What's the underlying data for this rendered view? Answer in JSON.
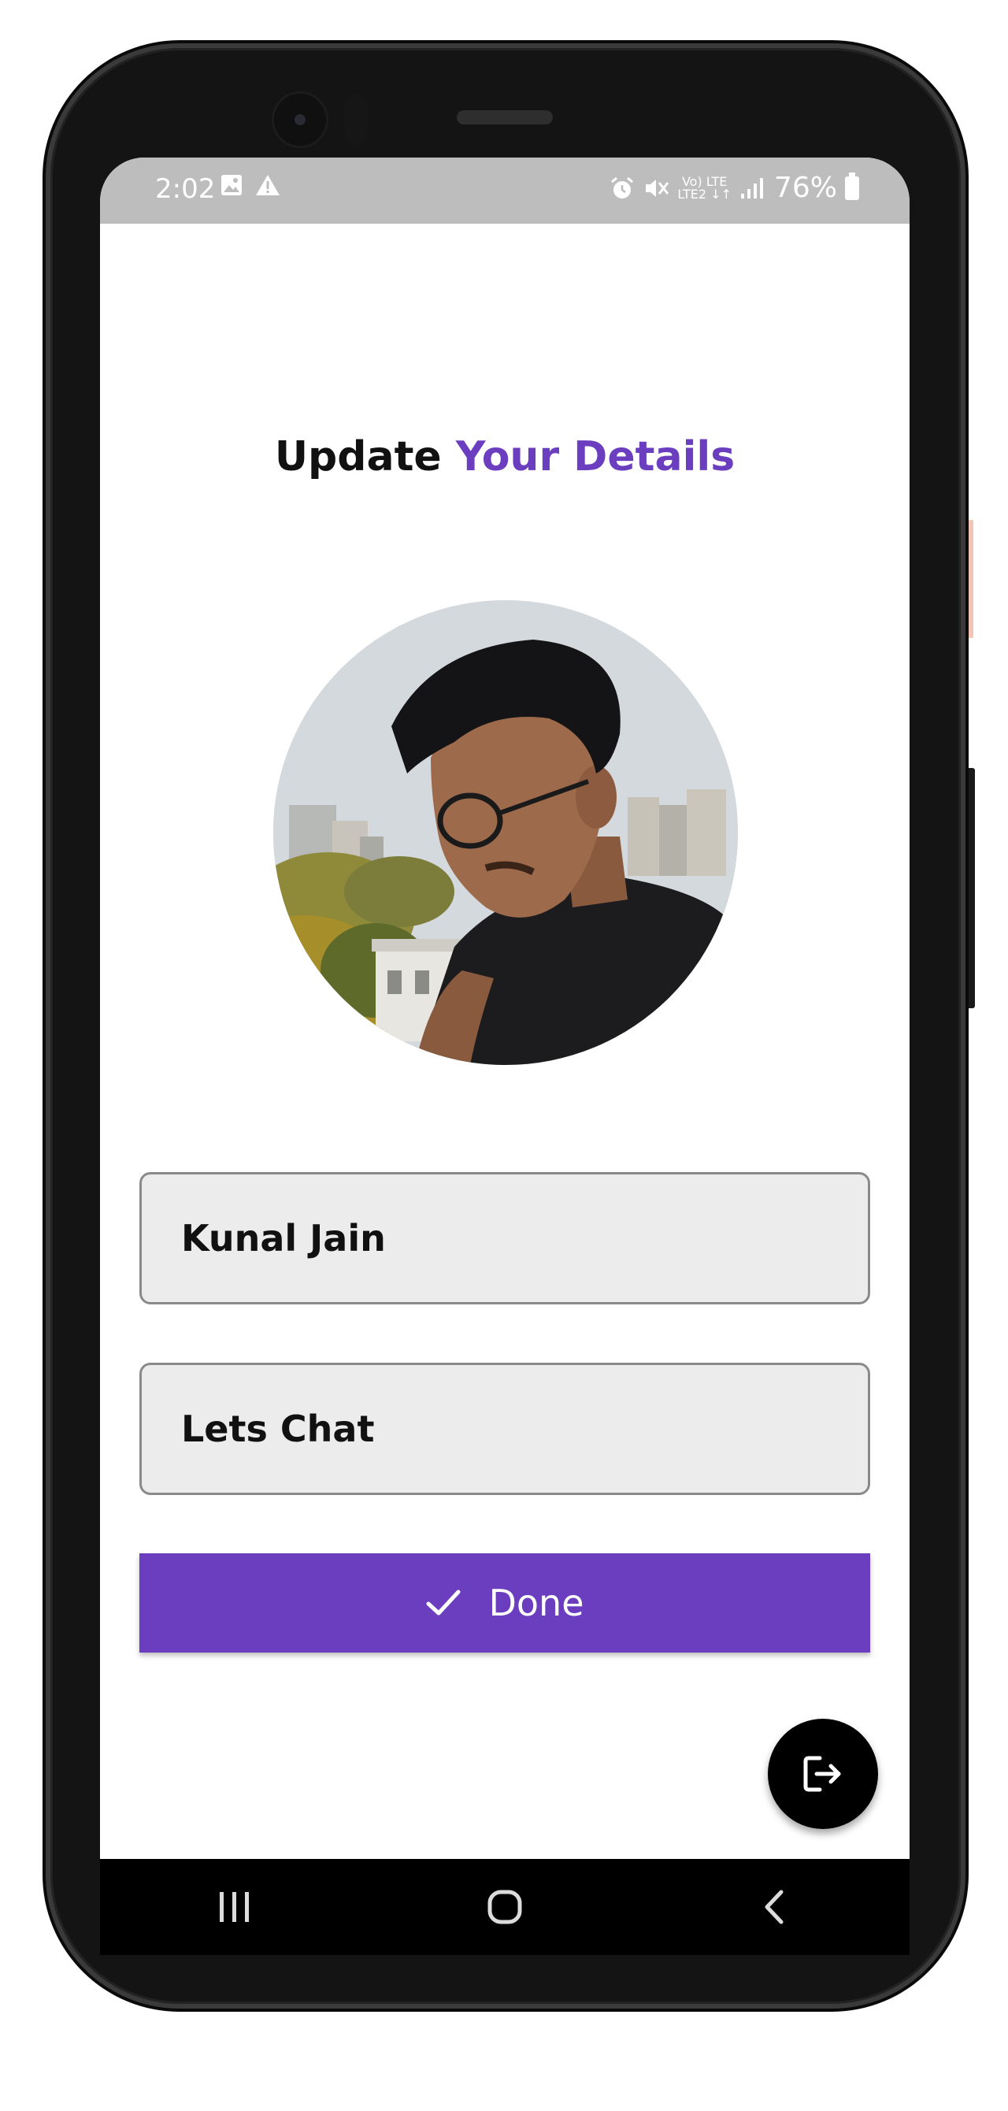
{
  "status_bar": {
    "time": "2:02",
    "battery": "76%",
    "network_top": "Vo) LTE",
    "network_bottom": "LTE2 ↓↑"
  },
  "header": {
    "title_part1": "Update",
    "title_part2": "Your Details"
  },
  "profile": {
    "avatar_icon": "profile-photo"
  },
  "form": {
    "name_value": "Kunal Jain",
    "status_value": "Lets Chat"
  },
  "actions": {
    "done_label": "Done",
    "logout_icon": "logout-icon"
  },
  "colors": {
    "accent": "#6a3ebf",
    "status_bar": "#bdbdbd",
    "field_bg": "#ececec",
    "fab_bg": "#000000"
  }
}
